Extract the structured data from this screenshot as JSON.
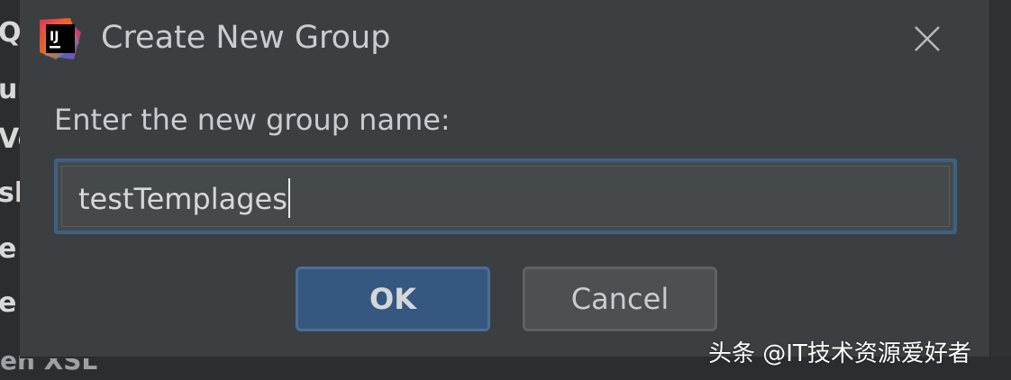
{
  "dialog": {
    "title": "Create New Group",
    "prompt": "Enter the new group name:",
    "input_value": "testTemplages",
    "ok_label": "OK",
    "cancel_label": "Cancel",
    "app_icon": "intellij-idea-icon",
    "app_icon_text": "IJ",
    "close_icon": "close-icon"
  },
  "background": {
    "side_fragments": [
      "Q",
      "ur",
      "Ve",
      "sl",
      "e",
      "e"
    ],
    "bottom_fragment": "en XSL"
  },
  "watermark": "头条 @IT技术资源爱好者",
  "colors": {
    "dialog_bg": "#3c3f41",
    "accent": "#365880",
    "focus_border": "#3d6185",
    "text": "#c9ccd0"
  }
}
